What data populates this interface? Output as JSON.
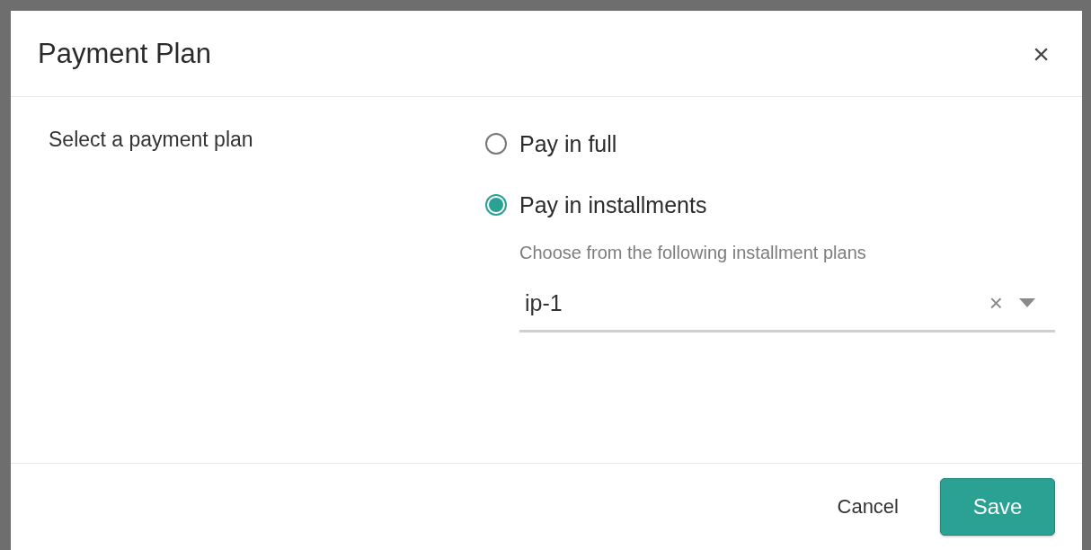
{
  "dialog": {
    "title": "Payment Plan",
    "close_label": "×"
  },
  "field_label": "Select a payment plan",
  "options": [
    {
      "label": "Pay in full",
      "selected": false
    },
    {
      "label": "Pay in installments",
      "selected": true
    }
  ],
  "installments": {
    "hint": "Choose from the following installment plans",
    "value": "ip-1",
    "clear_label": "×"
  },
  "buttons": [
    {
      "label": "Cancel",
      "kind": "text"
    },
    {
      "label": "Save",
      "kind": "primary"
    }
  ]
}
